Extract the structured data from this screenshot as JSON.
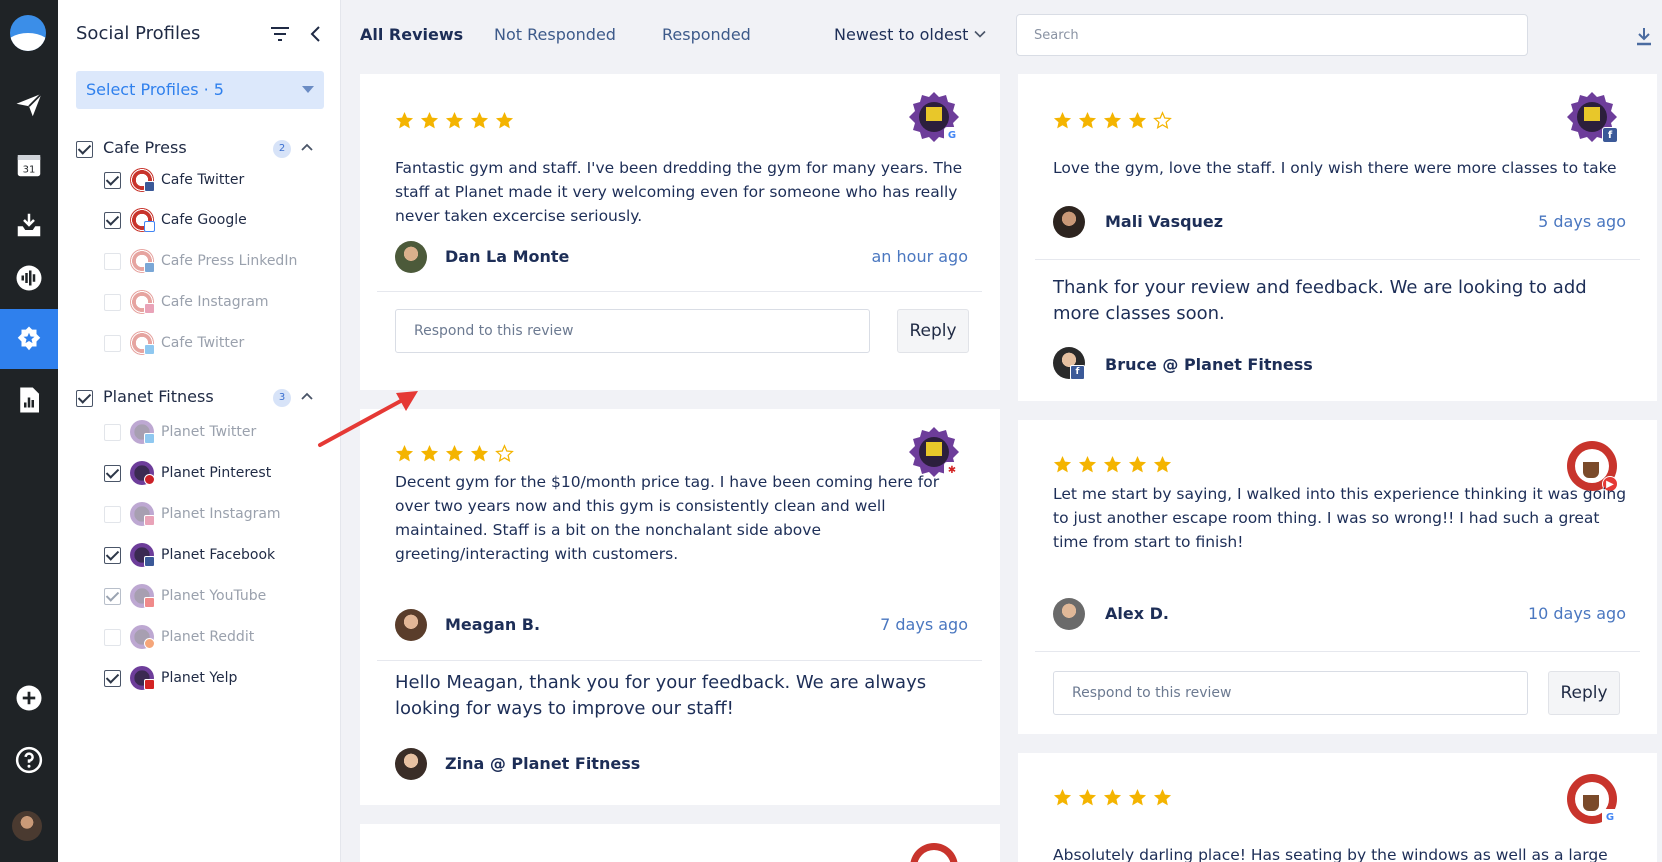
{
  "sidebar": {
    "title": "Social Profiles",
    "select_profiles": "Select Profiles · 5",
    "groups": [
      {
        "name": "Cafe Press",
        "count": "2",
        "profiles": [
          {
            "name": "Cafe Twitter",
            "checked": true,
            "network": "facebook"
          },
          {
            "name": "Cafe Google",
            "checked": true,
            "network": "google"
          },
          {
            "name": "Cafe Press LinkedIn",
            "checked": false,
            "network": "linkedin"
          },
          {
            "name": "Cafe Instagram",
            "checked": false,
            "network": "instagram"
          },
          {
            "name": "Cafe Twitter",
            "checked": false,
            "network": "twitter"
          }
        ]
      },
      {
        "name": "Planet Fitness",
        "count": "3",
        "profiles": [
          {
            "name": "Planet Twitter",
            "checked": false,
            "network": "twitter"
          },
          {
            "name": "Planet Pinterest",
            "checked": true,
            "network": "pinterest"
          },
          {
            "name": "Planet Instagram",
            "checked": false,
            "network": "instagram"
          },
          {
            "name": "Planet Facebook",
            "checked": true,
            "network": "facebook"
          },
          {
            "name": "Planet YouTube",
            "checked": true,
            "network": "youtube"
          },
          {
            "name": "Planet Reddit",
            "checked": false,
            "network": "reddit"
          },
          {
            "name": "Planet Yelp",
            "checked": true,
            "network": "yelp"
          }
        ]
      }
    ]
  },
  "topbar": {
    "tabs": [
      "All Reviews",
      "Not Responded",
      "Responded"
    ],
    "sort_label": "Newest to oldest",
    "search_placeholder": "Search"
  },
  "reviews": {
    "r1": {
      "rating": 5,
      "text": "Fantastic gym and staff. I've been dredding the gym for many years. The staff at Planet made it very welcoming even for someone who has really never taken excercise seriously.",
      "author": "Dan La Monte",
      "time": "an hour ago",
      "respond_placeholder": "Respond to this review",
      "reply_label": "Reply"
    },
    "r2": {
      "rating": 4,
      "text": "Decent gym for the $10/month price tag. I have been coming here for over two years now and this gym is consistently clean and well maintained. Staff is a bit on the nonchalant side above greeting/interacting with customers.",
      "author": "Meagan B.",
      "time": "7 days ago",
      "reply_text": "Hello Meagan, thank you for your feedback. We are always looking for ways to improve our staff!",
      "replier": "Zina @ Planet Fitness"
    },
    "r3": {
      "rating": 4,
      "text": "Love the gym, love the staff. I only wish there were more classes to take",
      "author": "Mali Vasquez",
      "time": "5 days ago",
      "reply_text": "Thank for your review and feedback. We are looking to add more classes soon.",
      "replier": "Bruce @ Planet Fitness"
    },
    "r4": {
      "rating": 5,
      "text": "Let me start by saying, I walked into this experience thinking it was going to just another escape room thing. I was so wrong!! I had such a great time from start to finish!",
      "author": "Alex D.",
      "time": "10 days ago",
      "respond_placeholder": "Respond to this review",
      "reply_label": "Reply"
    },
    "r5": {
      "rating": 5,
      "text": "Absolutely darling place! Has seating by the windows as well as a large"
    }
  },
  "colors": {
    "accent": "#2f80ed",
    "star": "#f4b400",
    "rail": "#1f2326",
    "annotation_arrow": "#e53935"
  }
}
